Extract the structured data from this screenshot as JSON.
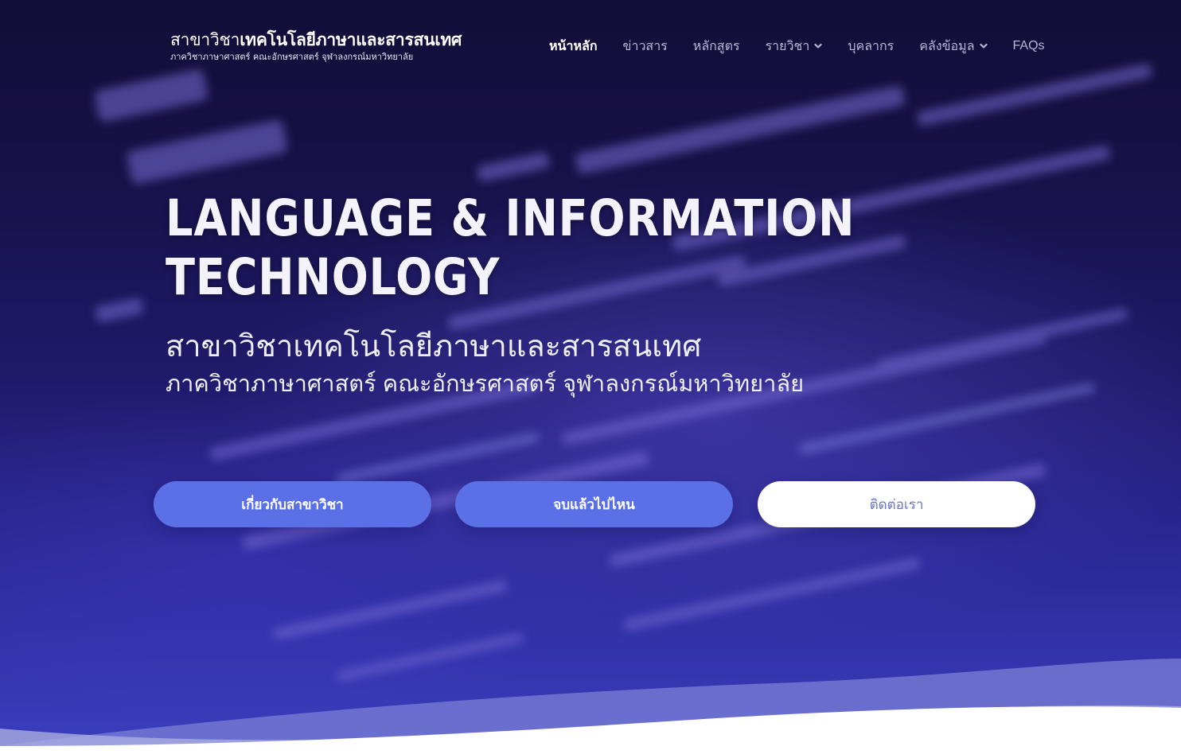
{
  "brand": {
    "title_light": "สาขาวิชา",
    "title_bold": "เทคโนโลยีภาษาและสารสนเทศ",
    "subtitle": "ภาควิชาภาษาศาสตร์ คณะอักษรศาสตร์ จุฬาลงกรณ์มหาวิทยาลัย"
  },
  "nav": {
    "items": [
      {
        "label": "หน้าหลัก",
        "active": true,
        "has_dropdown": false
      },
      {
        "label": "ข่าวสาร",
        "active": false,
        "has_dropdown": false
      },
      {
        "label": "หลักสูตร",
        "active": false,
        "has_dropdown": false
      },
      {
        "label": "รายวิชา",
        "active": false,
        "has_dropdown": true
      },
      {
        "label": "บุคลากร",
        "active": false,
        "has_dropdown": false
      },
      {
        "label": "คลังข้อมูล",
        "active": false,
        "has_dropdown": true
      },
      {
        "label": "FAQs",
        "active": false,
        "has_dropdown": false
      }
    ]
  },
  "hero": {
    "title_line1": "LANGUAGE & INFORMATION",
    "title_line2": "TECHNOLOGY",
    "subtitle_line1": "สาขาวิชาเทคโนโลยีภาษาและสารสนเทศ",
    "subtitle_line2": "ภาควิชาภาษาศาสตร์ คณะอักษรศาสตร์ จุฬาลงกรณ์มหาวิทยาลัย"
  },
  "buttons": {
    "about": "เกี่ยวกับสาขาวิชา",
    "careers": "จบแล้วไปไหน",
    "contact": "ติดต่อเรา"
  },
  "colors": {
    "primary_button": "#5b6fe6",
    "light_button_text": "#6b74c9",
    "nav_inactive": "#b8b6d6",
    "background_top": "#120d36",
    "background_bottom": "#3b3fbf"
  }
}
